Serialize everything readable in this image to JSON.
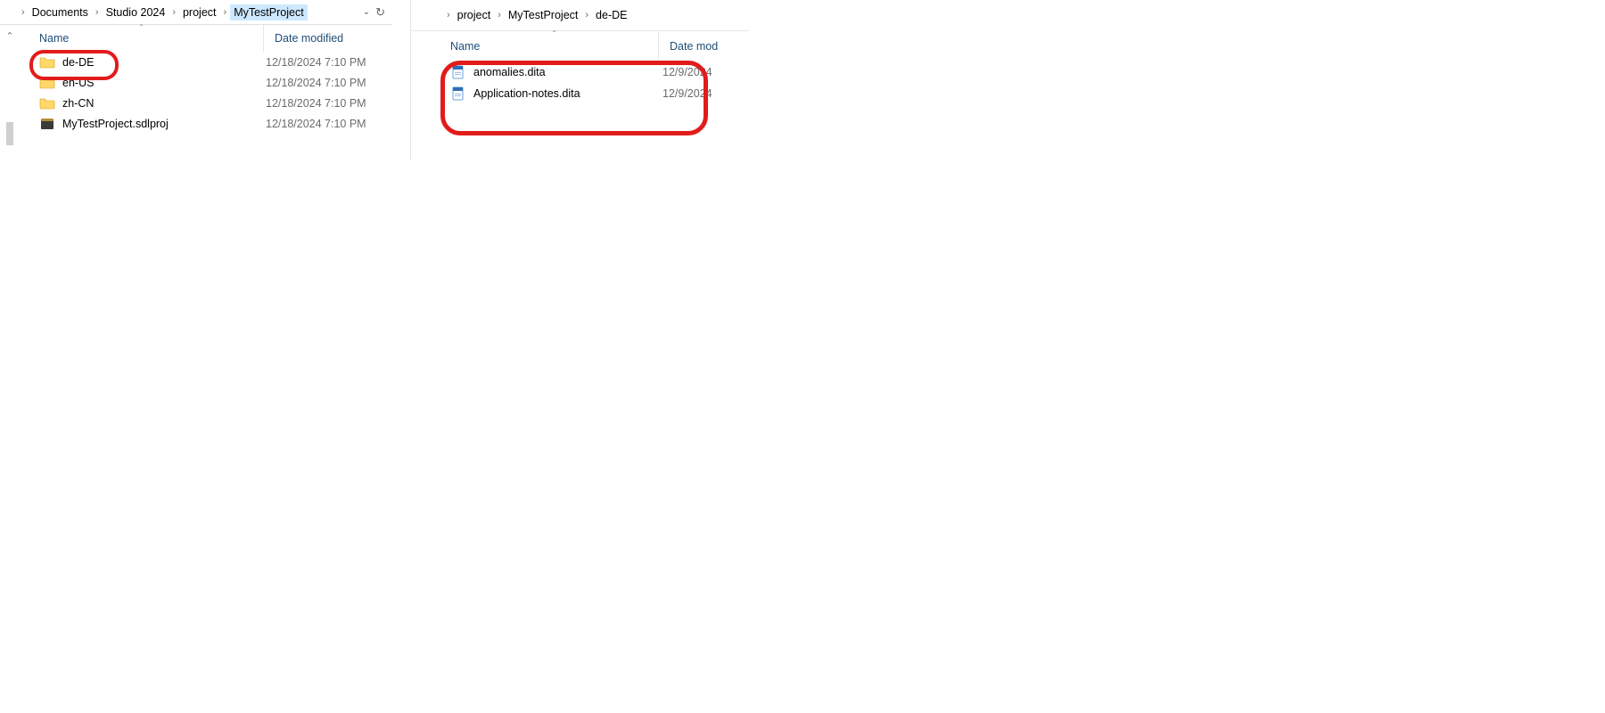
{
  "left": {
    "breadcrumbs": [
      "Documents",
      "Studio 2024",
      "project",
      "MyTestProject"
    ],
    "selected_crumb_index": 3,
    "columns": {
      "name": "Name",
      "date": "Date modified"
    },
    "items": [
      {
        "type": "folder",
        "name": "de-DE",
        "date": "12/18/2024 7:10 PM"
      },
      {
        "type": "folder",
        "name": "en-US",
        "date": "12/18/2024 7:10 PM"
      },
      {
        "type": "folder",
        "name": "zh-CN",
        "date": "12/18/2024 7:10 PM"
      },
      {
        "type": "proj",
        "name": "MyTestProject.sdlproj",
        "date": "12/18/2024 7:10 PM"
      }
    ]
  },
  "right": {
    "breadcrumbs": [
      "project",
      "MyTestProject",
      "de-DE"
    ],
    "columns": {
      "name": "Name",
      "date": "Date mod"
    },
    "items": [
      {
        "type": "dita",
        "name": "anomalies.dita",
        "date": "12/9/2024"
      },
      {
        "type": "dita",
        "name": "Application-notes.dita",
        "date": "12/9/2024"
      }
    ]
  }
}
